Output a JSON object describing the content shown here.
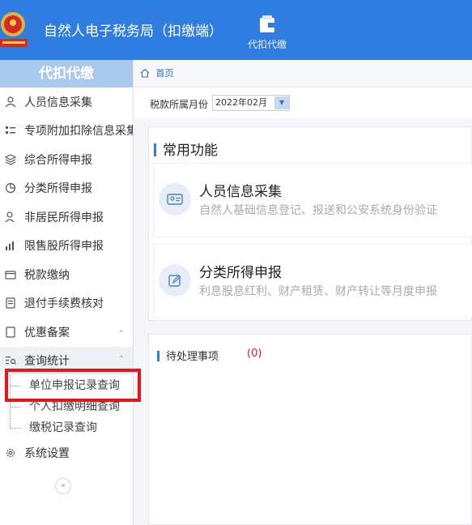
{
  "header": {
    "app_title": "自然人电子税务局（扣缴端）",
    "module_label": "代扣代缴",
    "logo_icon": "tax-emblem-icon"
  },
  "sidebar": {
    "heading": "代扣代缴",
    "items": [
      {
        "label": "人员信息采集",
        "icon": "person-icon"
      },
      {
        "label": "专项附加扣除信息采集",
        "icon": "list-icon"
      },
      {
        "label": "综合所得申报",
        "icon": "layers-icon"
      },
      {
        "label": "分类所得申报",
        "icon": "pie-icon"
      },
      {
        "label": "非居民所得申报",
        "icon": "user-icon"
      },
      {
        "label": "限售股所得申报",
        "icon": "bar-chart-icon"
      },
      {
        "label": "税款缴纳",
        "icon": "wallet-icon"
      },
      {
        "label": "退付手续费核对",
        "icon": "receipt-icon"
      },
      {
        "label": "优惠备案",
        "icon": "document-icon"
      },
      {
        "label": "查询统计",
        "icon": "query-icon"
      }
    ],
    "submenu": [
      {
        "label": "单位申报记录查询"
      },
      {
        "label": "个人扣缴明细查询"
      },
      {
        "label": "缴税记录查询"
      }
    ],
    "settings_label": "系统设置",
    "collapse_label": "«"
  },
  "breadcrumb": {
    "home": "首页"
  },
  "filter": {
    "label": "税款所属月份",
    "value": "2022年02月"
  },
  "common": {
    "title": "常用功能",
    "cards": [
      {
        "title": "人员信息采集",
        "desc": "自然人基础信息登记、报送和公安系统身份验证",
        "icon": "id-card-icon"
      },
      {
        "title": "分类所得申报",
        "desc": "利息股息红利、财产租赁、财产转让等月度申报",
        "icon": "edit-icon"
      }
    ]
  },
  "todo": {
    "title": "待处理事项",
    "count": "(0)"
  },
  "colors": {
    "primary": "#2f7de1",
    "highlight": "#e8141a",
    "sidebar_head": "#a9c9ee"
  }
}
